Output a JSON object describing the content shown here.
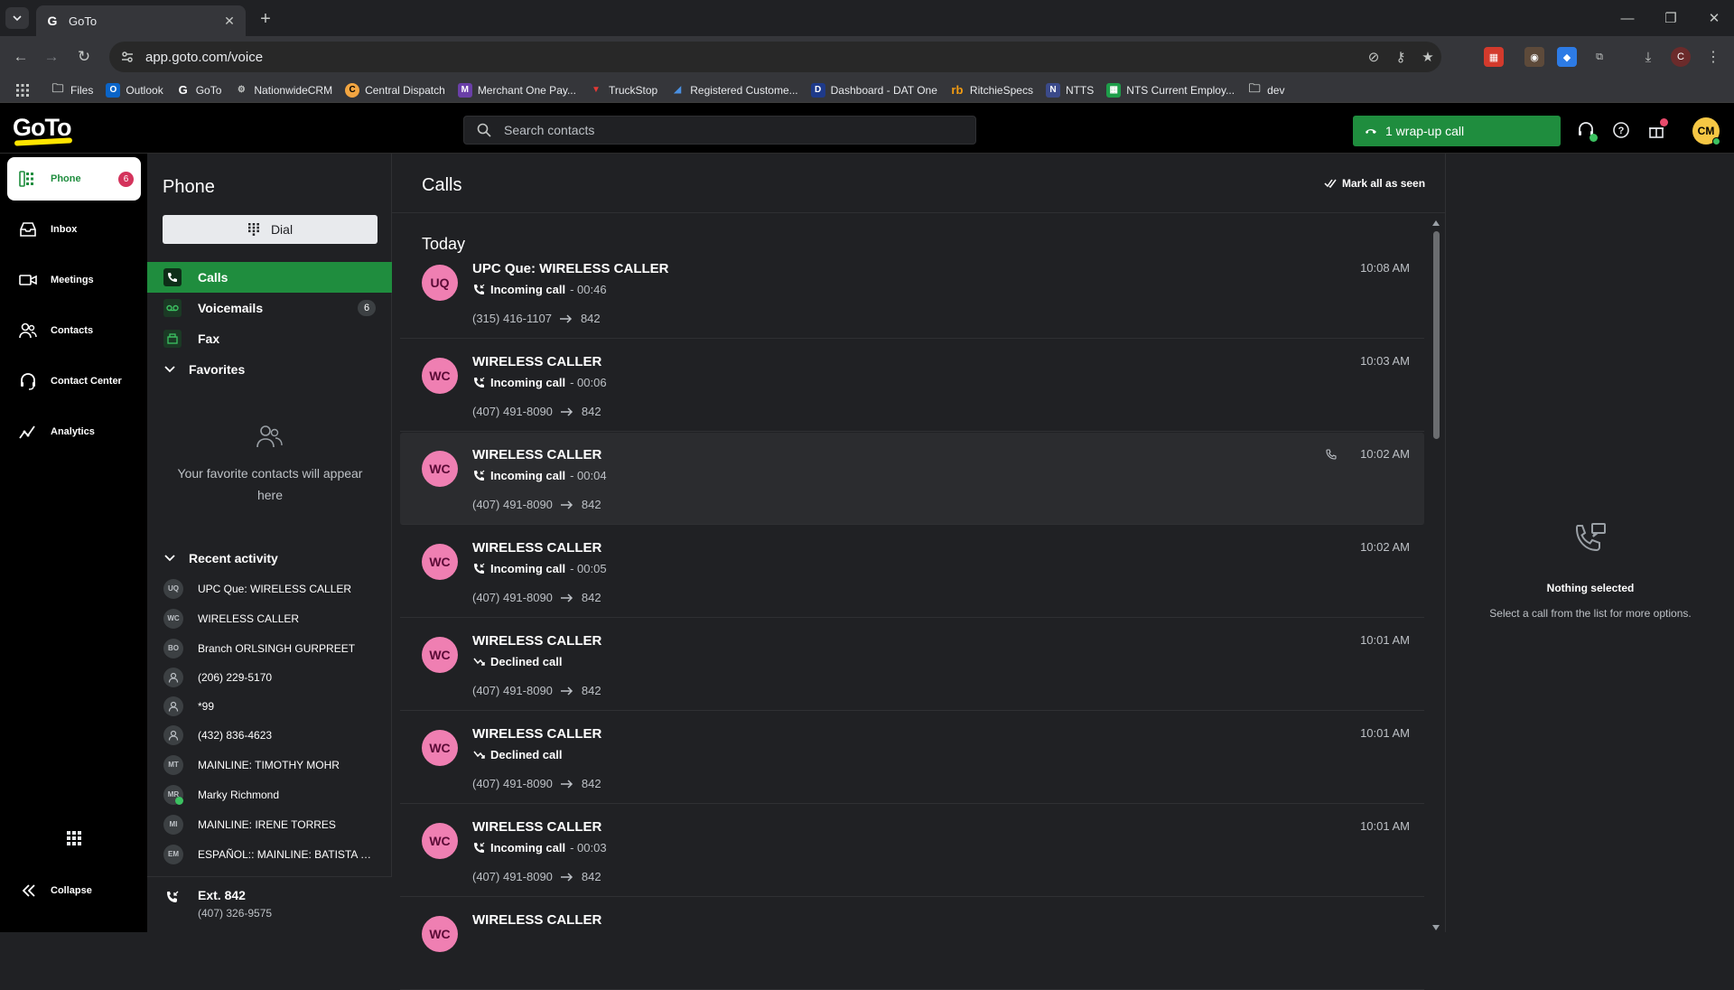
{
  "browser": {
    "tab_title": "GoTo",
    "url": "app.goto.com/voice",
    "profile_initial": "C",
    "bookmarks": [
      {
        "label": "Files",
        "icon": "folder-icon"
      },
      {
        "label": "Outlook",
        "icon": "outlook-icon"
      },
      {
        "label": "GoTo",
        "icon": "goto-icon"
      },
      {
        "label": "NationwideCRM",
        "icon": "crm-icon"
      },
      {
        "label": "Central Dispatch",
        "icon": "dispatch-icon"
      },
      {
        "label": "Merchant One Pay...",
        "icon": "merchant-icon"
      },
      {
        "label": "TruckStop",
        "icon": "truckstop-icon"
      },
      {
        "label": "Registered Custome...",
        "icon": "registered-icon"
      },
      {
        "label": "Dashboard - DAT One",
        "icon": "dat-icon"
      },
      {
        "label": "RitchieSpecs",
        "icon": "ritchie-icon"
      },
      {
        "label": "NTTS",
        "icon": "ntts-icon"
      },
      {
        "label": "NTS Current Employ...",
        "icon": "sheets-icon"
      },
      {
        "label": "dev",
        "icon": "folder-icon"
      }
    ]
  },
  "header": {
    "logo": "GoTo",
    "search_placeholder": "Search contacts",
    "wrapup_label": "1 wrap-up call",
    "avatar_initials": "CM"
  },
  "nav": {
    "items": [
      {
        "label": "Phone",
        "icon": "phone-grid-icon",
        "badge": "6"
      },
      {
        "label": "Inbox",
        "icon": "inbox-icon"
      },
      {
        "label": "Meetings",
        "icon": "video-icon"
      },
      {
        "label": "Contacts",
        "icon": "contacts-icon"
      },
      {
        "label": "Contact Center",
        "icon": "headset-icon"
      },
      {
        "label": "Analytics",
        "icon": "analytics-icon"
      }
    ],
    "collapse_label": "Collapse"
  },
  "phone_panel": {
    "title": "Phone",
    "dial_label": "Dial",
    "items": [
      {
        "label": "Calls",
        "count": ""
      },
      {
        "label": "Voicemails",
        "count": "6"
      },
      {
        "label": "Fax",
        "count": ""
      }
    ],
    "favorites_label": "Favorites",
    "favorites_empty": "Your favorite contacts will appear here",
    "recent_label": "Recent activity",
    "recent": [
      {
        "initials": "UQ",
        "name": "UPC Que: WIRELESS CALLER"
      },
      {
        "initials": "WC",
        "name": "WIRELESS CALLER"
      },
      {
        "initials": "BO",
        "name": "Branch ORLSINGH GURPREET"
      },
      {
        "initials": "",
        "name": "(206) 229-5170"
      },
      {
        "initials": "",
        "name": "*99"
      },
      {
        "initials": "",
        "name": "(432) 836-4623"
      },
      {
        "initials": "MT",
        "name": "MAINLINE: TIMOTHY MOHR"
      },
      {
        "initials": "MR",
        "name": "Marky Richmond"
      },
      {
        "initials": "MI",
        "name": "MAINLINE: IRENE TORRES"
      },
      {
        "initials": "EM",
        "name": "ESPAÑOL:: MAINLINE: BATISTA MA..."
      }
    ],
    "extension": {
      "title": "Ext. 842",
      "number": "(407) 326-9575"
    }
  },
  "calls": {
    "title": "Calls",
    "mark_all_label": "Mark all as seen",
    "section": "Today",
    "rows": [
      {
        "initials": "UQ",
        "name": "UPC Que: WIRELESS CALLER",
        "type": "Incoming call",
        "duration": "- 00:46",
        "from": "(315) 416-1107",
        "to": "842",
        "time": "10:08 AM"
      },
      {
        "initials": "WC",
        "name": "WIRELESS CALLER",
        "type": "Incoming call",
        "duration": "- 00:06",
        "from": "(407) 491-8090",
        "to": "842",
        "time": "10:03 AM"
      },
      {
        "initials": "WC",
        "name": "WIRELESS CALLER",
        "type": "Incoming call",
        "duration": "- 00:04",
        "from": "(407) 491-8090",
        "to": "842",
        "time": "10:02 AM"
      },
      {
        "initials": "WC",
        "name": "WIRELESS CALLER",
        "type": "Incoming call",
        "duration": "- 00:05",
        "from": "(407) 491-8090",
        "to": "842",
        "time": "10:02 AM"
      },
      {
        "initials": "WC",
        "name": "WIRELESS CALLER",
        "type": "Declined call",
        "duration": "",
        "from": "(407) 491-8090",
        "to": "842",
        "time": "10:01 AM"
      },
      {
        "initials": "WC",
        "name": "WIRELESS CALLER",
        "type": "Declined call",
        "duration": "",
        "from": "(407) 491-8090",
        "to": "842",
        "time": "10:01 AM"
      },
      {
        "initials": "WC",
        "name": "WIRELESS CALLER",
        "type": "Incoming call",
        "duration": "- 00:03",
        "from": "(407) 491-8090",
        "to": "842",
        "time": "10:01 AM"
      },
      {
        "initials": "WC",
        "name": "WIRELESS CALLER",
        "type": "",
        "duration": "",
        "from": "",
        "to": "",
        "time": ""
      }
    ]
  },
  "detail": {
    "title": "Nothing selected",
    "subtitle": "Select a call from the list for more options."
  },
  "colors": {
    "accent_green": "#1f8d3e",
    "avatar_pink": "#ef7fb2",
    "badge_red": "#d4335c",
    "logo_yellow": "#ffe500"
  }
}
